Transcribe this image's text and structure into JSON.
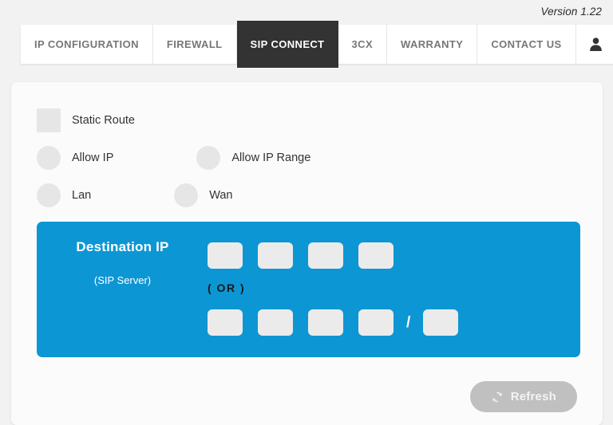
{
  "header": {
    "version": "Version 1.22"
  },
  "tabs": [
    {
      "label": "IP CONFIGURATION",
      "name": "tab-ip-configuration",
      "active": false
    },
    {
      "label": "FIREWALL",
      "name": "tab-firewall",
      "active": false
    },
    {
      "label": "SIP CONNECT",
      "name": "tab-sip-connect",
      "active": true
    },
    {
      "label": "3CX",
      "name": "tab-3cx",
      "active": false
    },
    {
      "label": "WARRANTY",
      "name": "tab-warranty",
      "active": false
    },
    {
      "label": "CONTACT US",
      "name": "tab-contact-us",
      "active": false
    }
  ],
  "account_tab": {
    "icon": "user-icon"
  },
  "options": {
    "static_route": {
      "label": "Static Route",
      "type": "checkbox",
      "checked": false
    },
    "allow_ip": {
      "label": "Allow IP",
      "type": "radio",
      "checked": false
    },
    "allow_ip_range": {
      "label": "Allow IP Range",
      "type": "radio",
      "checked": false
    },
    "lan": {
      "label": "Lan",
      "type": "radio",
      "checked": false
    },
    "wan": {
      "label": "Wan",
      "type": "radio",
      "checked": false
    }
  },
  "destination_panel": {
    "title": "Destination IP",
    "subtitle": "(SIP Server)",
    "or_label": "( OR )",
    "separator": "/",
    "accent_color": "#0d96d4",
    "ip_single": [
      "",
      "",
      "",
      ""
    ],
    "ip_range": [
      "",
      "",
      "",
      ""
    ],
    "cidr": ""
  },
  "footer": {
    "refresh_label": "Refresh",
    "refresh_icon": "refresh-icon"
  },
  "colors": {
    "page_background": "#f2f2f2",
    "card_background": "#fbfbfb",
    "active_tab": "#333333",
    "accent_blue": "#0d96d4",
    "control_gray": "#e6e6e6",
    "button_gray": "#c0c0c0"
  }
}
